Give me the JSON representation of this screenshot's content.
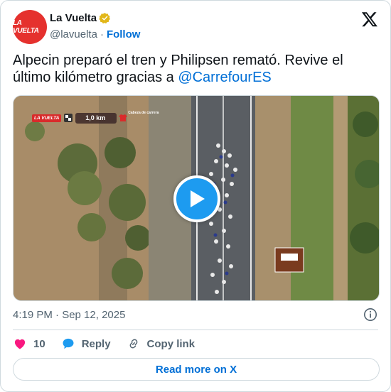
{
  "account": {
    "avatar_text": "LA VUELTA",
    "display_name": "La Vuelta",
    "handle": "@lavuelta",
    "separator": "·",
    "follow_label": "Follow"
  },
  "tweet": {
    "text_before": "Alpecin preparó el tren y Philipsen remató. Revive el último kilómetro gracias a ",
    "mention": "@CarrefourES"
  },
  "media": {
    "overlay_brand": "LA VUELTA",
    "overlay_caption": "Cabeza de carrera",
    "overlay_distance": "1,0 km"
  },
  "meta": {
    "timestamp": "4:19 PM · Sep 12, 2025"
  },
  "actions": {
    "like_count": "10",
    "reply_label": "Reply",
    "copy_label": "Copy link"
  },
  "footer": {
    "read_more_label": "Read more on X"
  },
  "colors": {
    "accent": "#006fd6",
    "like": "#f91880",
    "reply": "#1d9bf0",
    "brand": "#e5312e"
  }
}
